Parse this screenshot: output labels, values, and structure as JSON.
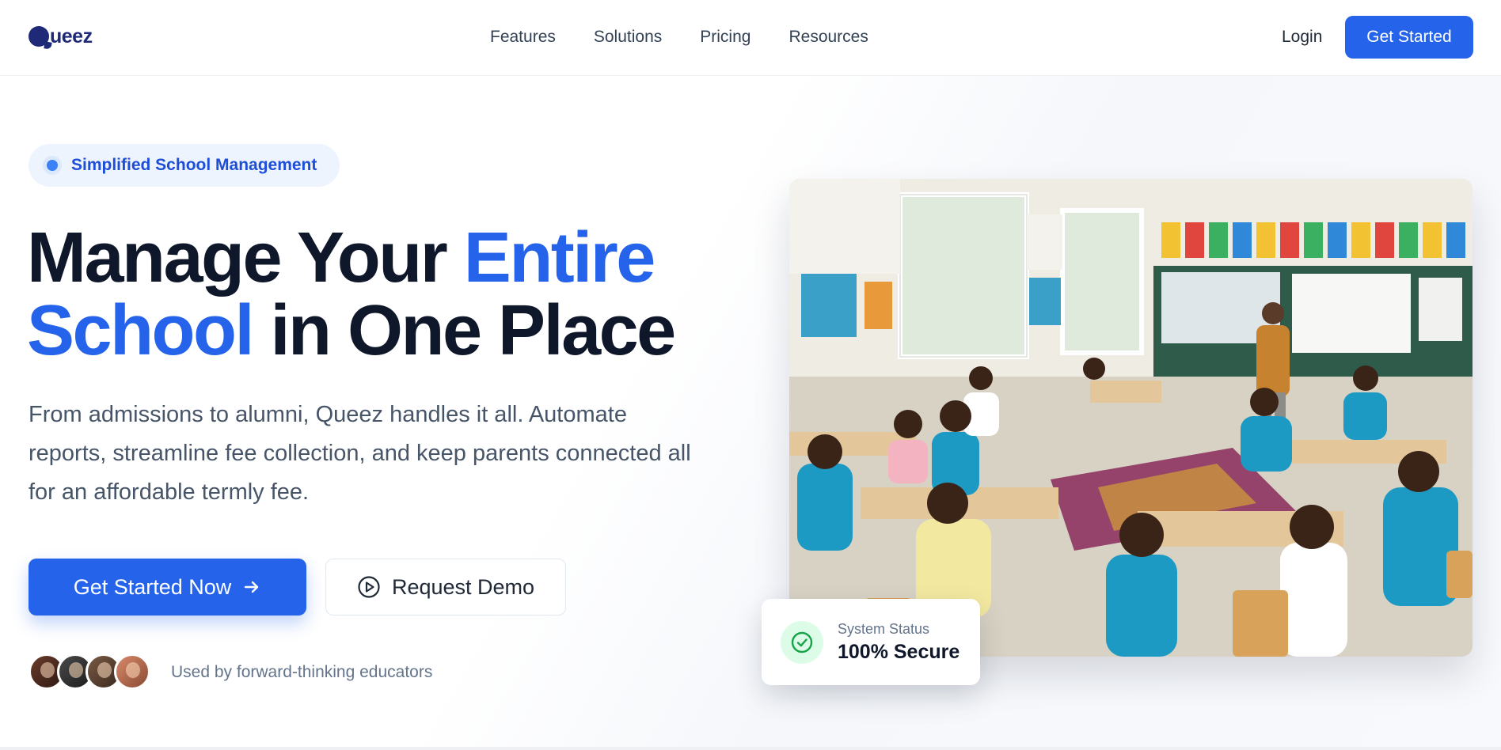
{
  "nav": {
    "logo_rest": "ueez",
    "links": [
      "Features",
      "Solutions",
      "Pricing",
      "Resources"
    ],
    "login": "Login",
    "cta": "Get Started"
  },
  "hero": {
    "badge": "Simplified School Management",
    "headline": {
      "part1": "Manage Your ",
      "accent1": "Entire",
      "accent2": "School",
      "part2": " in One Place"
    },
    "subtext": "From admissions to alumni, Queez handles it all. Automate reports, streamline fee collection, and keep parents connected all for an affordable termly fee.",
    "primary_cta": "Get Started Now",
    "secondary_cta": "Request Demo",
    "social_proof": "Used by forward-thinking educators"
  },
  "status": {
    "label": "System Status",
    "value": "100% Secure"
  },
  "colors": {
    "brand_navy": "#1e2a78",
    "accent_blue": "#2563eb",
    "success_green": "#16a34a"
  },
  "icons": {
    "primary_cta": "arrow-right-icon",
    "secondary_cta": "play-circle-icon",
    "status": "check-circle-icon"
  }
}
